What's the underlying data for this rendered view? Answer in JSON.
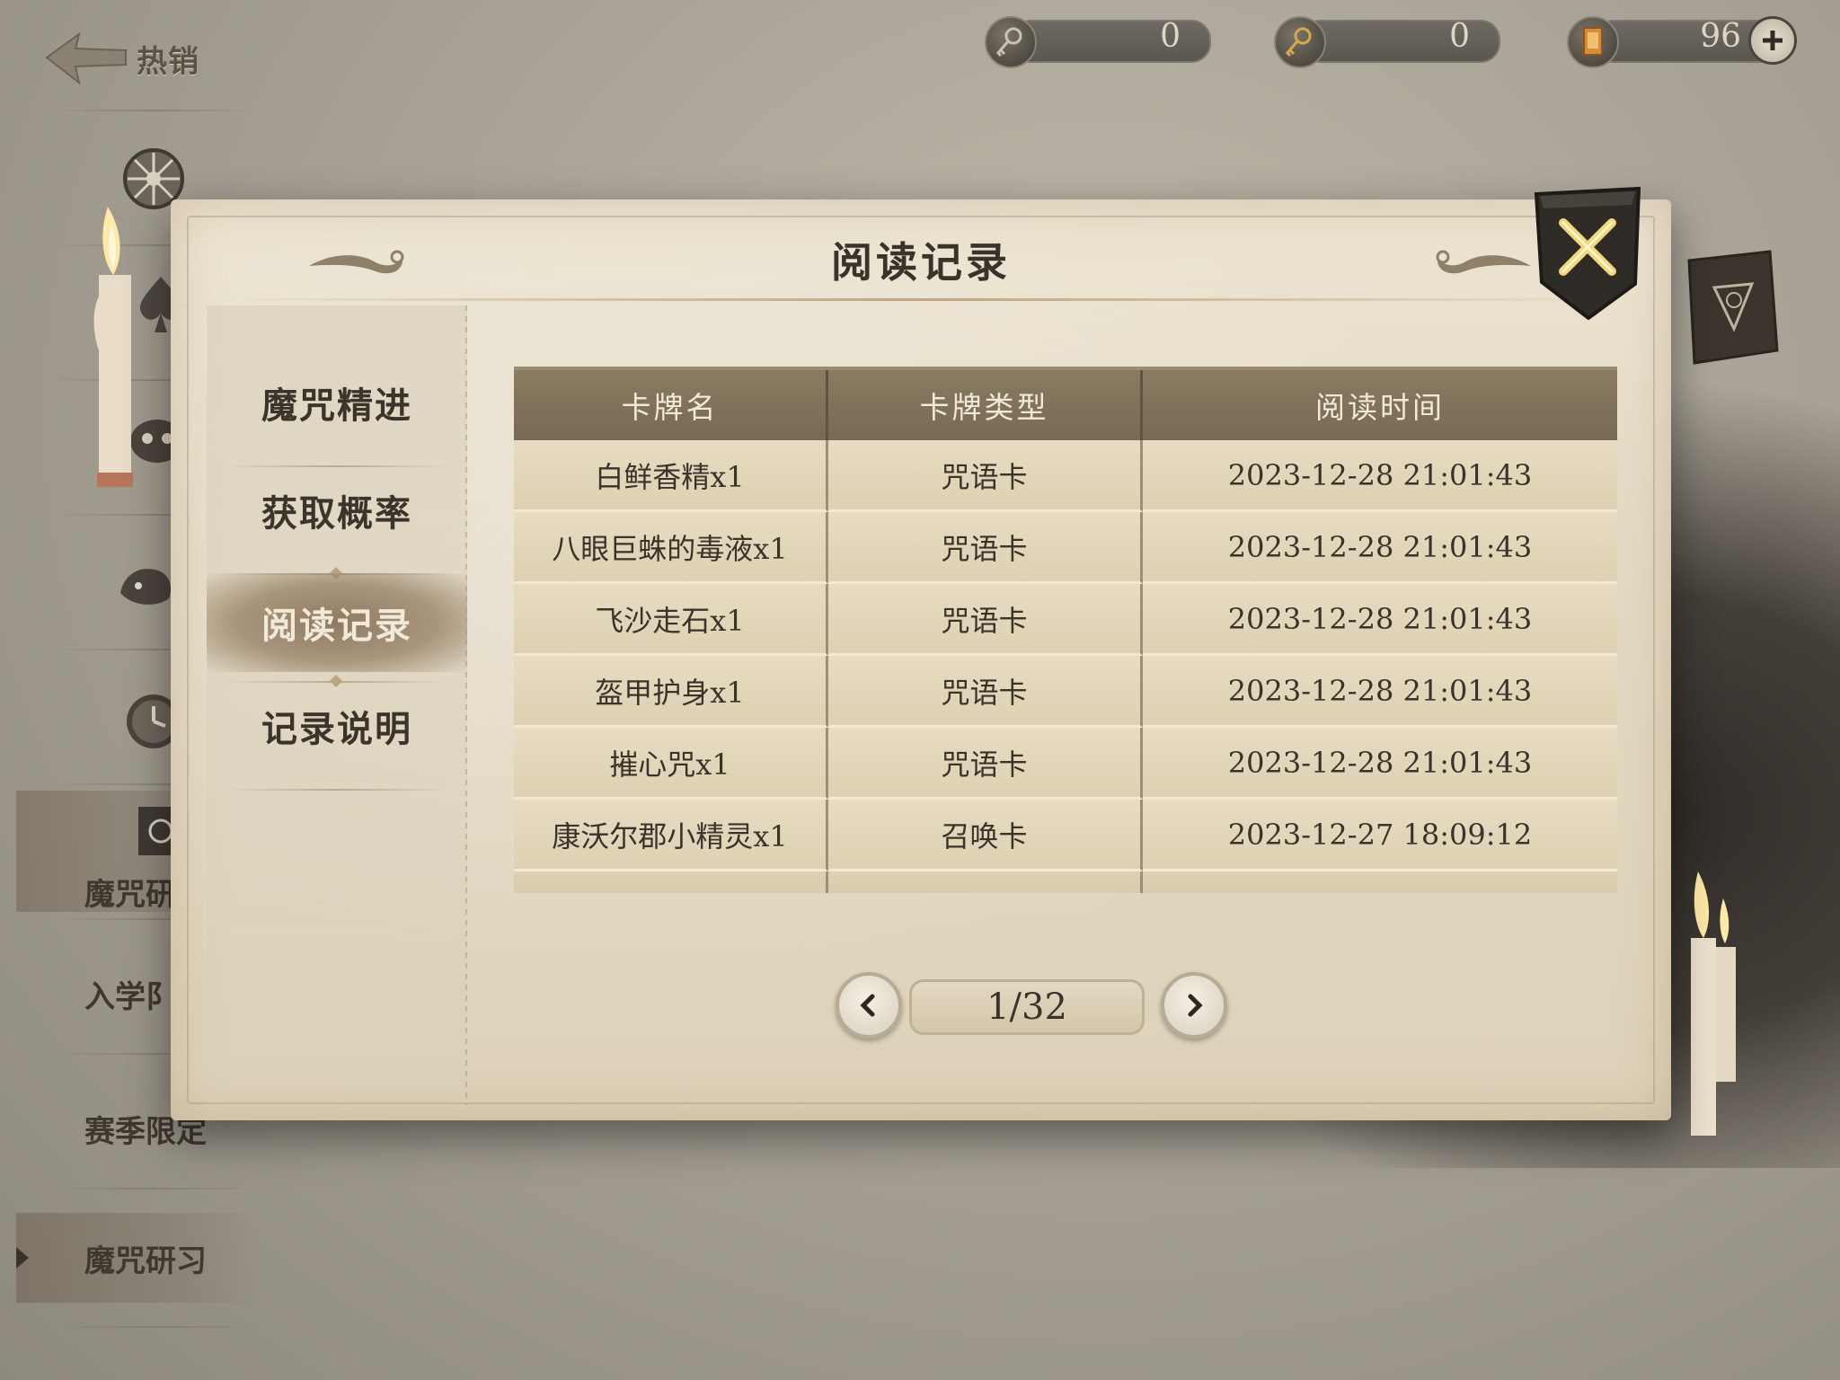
{
  "header": {
    "back_label": "热销",
    "currencies": [
      {
        "icon": "silver-key-icon",
        "value": "0"
      },
      {
        "icon": "gold-key-icon",
        "value": "0"
      },
      {
        "icon": "spell-card-icon",
        "value": "96"
      }
    ]
  },
  "background_sidebar": {
    "labels": {
      "partial_1": "魔咒研",
      "partial_2": "入学阝",
      "partial_3": "赛季限定",
      "active": "魔咒研习"
    }
  },
  "dialog": {
    "title": "阅读记录",
    "nav": [
      {
        "label": "魔咒精进",
        "active": false
      },
      {
        "label": "获取概率",
        "active": false
      },
      {
        "label": "阅读记录",
        "active": true
      },
      {
        "label": "记录说明",
        "active": false
      }
    ],
    "table": {
      "headers": [
        "卡牌名",
        "卡牌类型",
        "阅读时间"
      ],
      "rows": [
        [
          "白鲜香精x1",
          "咒语卡",
          "2023-12-28 21:01:43"
        ],
        [
          "八眼巨蛛的毒液x1",
          "咒语卡",
          "2023-12-28 21:01:43"
        ],
        [
          "飞沙走石x1",
          "咒语卡",
          "2023-12-28 21:01:43"
        ],
        [
          "盔甲护身x1",
          "咒语卡",
          "2023-12-28 21:01:43"
        ],
        [
          "摧心咒x1",
          "咒语卡",
          "2023-12-28 21:01:43"
        ],
        [
          "康沃尔郡小精灵x1",
          "召唤卡",
          "2023-12-27 18:09:12"
        ]
      ]
    },
    "pager": {
      "text": "1/32"
    }
  },
  "colors": {
    "header_bar": "#7f715a",
    "active_nav": "#8c765c",
    "close_button": "#2f2b27",
    "close_x": "#f0d47a"
  }
}
